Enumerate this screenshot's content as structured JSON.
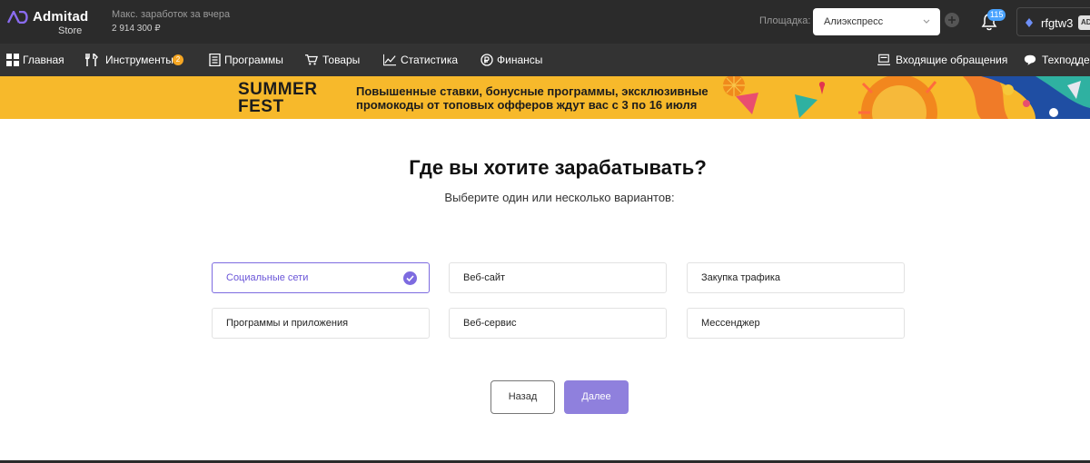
{
  "header": {
    "logo_title": "Admitad",
    "logo_subtitle": "Store",
    "earnings_label": "Макс. заработок за вчера",
    "earnings_value": "2 914 300 ₽",
    "platform_label": "Площадка:",
    "platform_value": "Алиэкспресс",
    "notifications_count": "115",
    "username": "rfgtw3",
    "user_badge": "AD"
  },
  "nav": {
    "items": [
      {
        "label": "Главная",
        "icon": "grid-icon"
      },
      {
        "label": "Инструменты",
        "icon": "tools-icon",
        "count": "2"
      },
      {
        "label": "Программы",
        "icon": "document-icon"
      },
      {
        "label": "Товары",
        "icon": "cart-icon"
      },
      {
        "label": "Статистика",
        "icon": "chart-icon"
      },
      {
        "label": "Финансы",
        "icon": "coin-icon"
      }
    ],
    "right_items": [
      {
        "label": "Входящие обращения",
        "icon": "inbox-icon"
      },
      {
        "label": "Техподдержка",
        "icon": "chat-icon"
      }
    ]
  },
  "banner": {
    "title_line1": "SUMMER",
    "title_line2": "FEST",
    "text_line1": "Повышенные ставки, бонусные программы, эксклюзивные",
    "text_line2": "промокоды от топовых офферов ждут вас с 3 по 16 июля"
  },
  "main": {
    "heading": "Где вы хотите зарабатывать?",
    "subheading": "Выберите один или несколько вариантов:",
    "options": [
      {
        "label": "Социальные сети",
        "selected": true
      },
      {
        "label": "Веб-сайт",
        "selected": false
      },
      {
        "label": "Закупка трафика",
        "selected": false
      },
      {
        "label": "Программы и приложения",
        "selected": false
      },
      {
        "label": "Веб-сервис",
        "selected": false
      },
      {
        "label": "Мессенджер",
        "selected": false
      }
    ],
    "back_label": "Назад",
    "next_label": "Далее"
  },
  "colors": {
    "accent": "#7d6be0",
    "header_bg": "#2b2b2b",
    "nav_bg": "#333333",
    "banner_bg": "#f7b92b",
    "badge": "#4aa3ff"
  }
}
